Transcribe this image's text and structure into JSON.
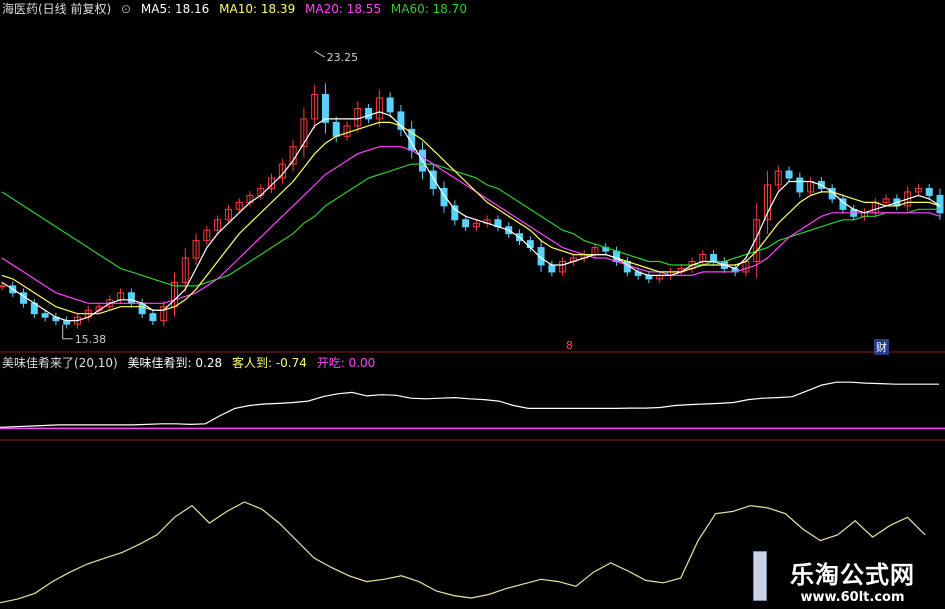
{
  "header": {
    "title": "海医药(日线 前复权)",
    "ma5": "MA5: 18.16",
    "ma10": "MA10: 18.39",
    "ma20": "MA20: 18.55",
    "ma60": "MA60: 18.70"
  },
  "indicator": {
    "name": "美味佳肴来了(20,10)",
    "v1": "美味佳肴到: 0.28",
    "v2": "客人到: -0.74",
    "v3": "开吃: 0.00"
  },
  "markers": {
    "m1": "8",
    "m2": "财"
  },
  "watermark": {
    "cn": "乐淘公式网",
    "url": "www.60lt.com"
  },
  "colors": {
    "up": "#ff3b3b",
    "down": "#5ad2ff",
    "ma5": "#ffffff",
    "ma10": "#ffff66",
    "ma20": "#ff44ff",
    "ma60": "#33cc33",
    "ind": "#ffffff",
    "ind2": "#ff44ff",
    "osc": "#e6e6a0"
  },
  "chart_data": {
    "type": "line",
    "price": {
      "high_label": "23.25",
      "low_label": "15.38",
      "ylim": [
        14.8,
        24.2
      ],
      "close": [
        16.5,
        16.3,
        16.0,
        15.7,
        15.6,
        15.5,
        15.4,
        15.6,
        15.8,
        15.9,
        16.1,
        16.3,
        16.0,
        15.7,
        15.5,
        15.9,
        16.6,
        17.3,
        17.8,
        18.1,
        18.4,
        18.7,
        18.9,
        19.1,
        19.3,
        19.6,
        20.0,
        20.5,
        21.3,
        22.0,
        21.2,
        20.8,
        21.1,
        21.6,
        21.3,
        21.9,
        21.5,
        21.0,
        20.4,
        19.8,
        19.3,
        18.8,
        18.4,
        18.2,
        18.3,
        18.4,
        18.2,
        18.0,
        17.8,
        17.6,
        17.1,
        16.9,
        17.2,
        17.3,
        17.4,
        17.6,
        17.5,
        17.2,
        16.9,
        16.8,
        16.7,
        16.8,
        16.9,
        17.0,
        17.2,
        17.4,
        17.2,
        17.0,
        16.9,
        17.2,
        18.4,
        19.4,
        19.8,
        19.6,
        19.2,
        19.5,
        19.3,
        19.0,
        18.7,
        18.5,
        18.6,
        18.9,
        19.0,
        18.8,
        19.2,
        19.3,
        19.1,
        18.6
      ],
      "ma5": [
        16.6,
        16.4,
        16.2,
        16.0,
        15.8,
        15.6,
        15.5,
        15.5,
        15.6,
        15.8,
        16.0,
        16.1,
        16.1,
        16.0,
        15.8,
        15.8,
        16.1,
        16.4,
        17.0,
        17.6,
        18.0,
        18.3,
        18.6,
        18.9,
        19.1,
        19.4,
        19.7,
        20.1,
        20.6,
        21.1,
        21.3,
        21.3,
        21.3,
        21.3,
        21.4,
        21.5,
        21.4,
        21.1,
        20.6,
        20.1,
        19.6,
        19.1,
        18.7,
        18.5,
        18.4,
        18.3,
        18.2,
        18.1,
        17.9,
        17.6,
        17.3,
        17.1,
        17.1,
        17.2,
        17.3,
        17.4,
        17.4,
        17.3,
        17.1,
        16.9,
        16.8,
        16.8,
        16.8,
        16.9,
        17.1,
        17.2,
        17.2,
        17.1,
        17.0,
        17.3,
        17.9,
        18.6,
        19.2,
        19.5,
        19.5,
        19.5,
        19.4,
        19.2,
        18.9,
        18.7,
        18.6,
        18.7,
        18.8,
        18.9,
        19.0,
        19.1,
        19.0,
        18.8
      ],
      "ma10": [
        16.8,
        16.7,
        16.5,
        16.3,
        16.1,
        15.9,
        15.8,
        15.7,
        15.7,
        15.7,
        15.8,
        15.9,
        15.9,
        15.9,
        15.8,
        15.8,
        15.9,
        16.1,
        16.4,
        16.8,
        17.2,
        17.6,
        18.0,
        18.3,
        18.6,
        18.9,
        19.2,
        19.5,
        19.9,
        20.3,
        20.6,
        20.8,
        20.9,
        21.0,
        21.1,
        21.2,
        21.2,
        21.1,
        20.9,
        20.7,
        20.4,
        20.1,
        19.8,
        19.5,
        19.2,
        18.9,
        18.7,
        18.5,
        18.3,
        18.1,
        17.8,
        17.6,
        17.5,
        17.4,
        17.4,
        17.4,
        17.4,
        17.3,
        17.2,
        17.1,
        17.0,
        16.9,
        16.9,
        16.9,
        17.0,
        17.1,
        17.1,
        17.1,
        17.1,
        17.2,
        17.5,
        17.9,
        18.3,
        18.6,
        18.9,
        19.1,
        19.2,
        19.2,
        19.1,
        19.0,
        18.9,
        18.9,
        18.8,
        18.8,
        18.9,
        18.9,
        18.9,
        18.8
      ],
      "ma20": [
        17.3,
        17.1,
        16.9,
        16.7,
        16.5,
        16.3,
        16.2,
        16.1,
        16.0,
        16.0,
        16.0,
        16.0,
        16.0,
        16.0,
        16.0,
        16.0,
        16.1,
        16.2,
        16.3,
        16.5,
        16.7,
        17.0,
        17.3,
        17.6,
        17.9,
        18.2,
        18.5,
        18.8,
        19.1,
        19.4,
        19.7,
        19.9,
        20.1,
        20.3,
        20.4,
        20.5,
        20.5,
        20.5,
        20.4,
        20.2,
        20.0,
        19.8,
        19.6,
        19.4,
        19.2,
        19.0,
        18.8,
        18.6,
        18.4,
        18.2,
        18.0,
        17.8,
        17.6,
        17.5,
        17.4,
        17.3,
        17.3,
        17.2,
        17.1,
        17.0,
        16.9,
        16.9,
        16.8,
        16.8,
        16.8,
        16.9,
        16.9,
        16.9,
        16.9,
        17.0,
        17.1,
        17.3,
        17.6,
        17.9,
        18.1,
        18.3,
        18.5,
        18.6,
        18.6,
        18.6,
        18.6,
        18.6,
        18.6,
        18.6,
        18.6,
        18.6,
        18.6,
        18.5
      ],
      "ma60": [
        19.2,
        19.0,
        18.8,
        18.6,
        18.4,
        18.2,
        18.0,
        17.8,
        17.6,
        17.4,
        17.2,
        17.0,
        16.9,
        16.8,
        16.7,
        16.6,
        16.5,
        16.5,
        16.5,
        16.6,
        16.7,
        16.8,
        17.0,
        17.2,
        17.4,
        17.6,
        17.8,
        18.0,
        18.3,
        18.5,
        18.8,
        19.0,
        19.2,
        19.4,
        19.6,
        19.7,
        19.8,
        19.9,
        20.0,
        20.0,
        20.0,
        19.9,
        19.8,
        19.7,
        19.6,
        19.4,
        19.3,
        19.1,
        18.9,
        18.7,
        18.5,
        18.3,
        18.1,
        18.0,
        17.8,
        17.7,
        17.6,
        17.5,
        17.4,
        17.3,
        17.2,
        17.2,
        17.1,
        17.1,
        17.1,
        17.1,
        17.2,
        17.2,
        17.3,
        17.4,
        17.5,
        17.6,
        17.8,
        17.9,
        18.0,
        18.1,
        18.2,
        18.3,
        18.4,
        18.4,
        18.5,
        18.5,
        18.6,
        18.6,
        18.6,
        18.7,
        18.7,
        18.7
      ]
    },
    "indicator": {
      "ylim": [
        -1.0,
        1.2
      ],
      "line": [
        -0.7,
        -0.68,
        -0.66,
        -0.64,
        -0.62,
        -0.62,
        -0.62,
        -0.62,
        -0.62,
        -0.62,
        -0.6,
        -0.58,
        -0.58,
        -0.6,
        -0.58,
        -0.3,
        -0.05,
        0.05,
        0.1,
        0.12,
        0.15,
        0.2,
        0.35,
        0.45,
        0.5,
        0.38,
        0.42,
        0.4,
        0.3,
        0.28,
        0.3,
        0.32,
        0.28,
        0.25,
        0.2,
        0.05,
        -0.05,
        -0.05,
        -0.05,
        -0.05,
        -0.05,
        -0.05,
        -0.05,
        -0.04,
        -0.04,
        -0.02,
        0.05,
        0.08,
        0.1,
        0.12,
        0.15,
        0.25,
        0.3,
        0.32,
        0.35,
        0.55,
        0.75,
        0.85,
        0.85,
        0.82,
        0.8,
        0.78,
        0.78,
        0.78,
        0.78
      ],
      "base": -0.74
    },
    "oscillator": {
      "ylim": [
        0,
        10
      ],
      "line": [
        0.2,
        0.5,
        1.0,
        2.0,
        2.8,
        3.5,
        4.0,
        4.5,
        5.2,
        6.0,
        7.5,
        8.5,
        7.0,
        8.0,
        8.8,
        8.2,
        7.0,
        5.5,
        4.0,
        3.2,
        2.5,
        2.0,
        2.2,
        2.5,
        2.0,
        1.2,
        0.8,
        0.6,
        0.9,
        1.4,
        1.8,
        2.2,
        2.0,
        1.6,
        2.8,
        3.6,
        2.9,
        2.1,
        1.9,
        2.3,
        5.5,
        7.8,
        8.0,
        8.5,
        8.3,
        7.8,
        6.5,
        5.5,
        6.0,
        7.2,
        5.8,
        6.8,
        7.5,
        6.0
      ]
    }
  }
}
